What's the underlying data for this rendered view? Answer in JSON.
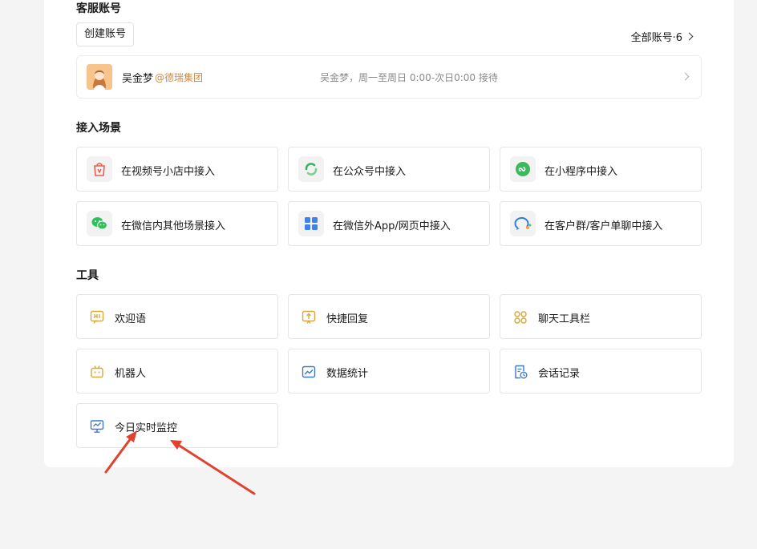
{
  "sections": {
    "accounts_title": "客服账号",
    "scenes_title": "接入场景",
    "tools_title": "工具"
  },
  "accounts": {
    "create_label": "创建账号",
    "all_label": "全部账号·6",
    "row": {
      "name": "吴金梦",
      "org": "@德瑞集团",
      "hours": "吴金梦，周一至周日 0:00-次日0:00 接待"
    }
  },
  "scenes": [
    {
      "label": "在视频号小店中接入",
      "icon": "shop-bag-icon",
      "color": "#e8604c"
    },
    {
      "label": "在公众号中接入",
      "icon": "official-account-icon",
      "color": "#2fb55d"
    },
    {
      "label": "在小程序中接入",
      "icon": "mini-program-icon",
      "color": "#3cb95c"
    },
    {
      "label": "在微信内其他场景接入",
      "icon": "wechat-icon",
      "color": "#2dc15a"
    },
    {
      "label": "在微信外App/网页中接入",
      "icon": "app-grid-icon",
      "color": "#3d82f0"
    },
    {
      "label": "在客户群/客户单聊中接入",
      "icon": "customer-chat-icon",
      "color": "#2f7de1"
    }
  ],
  "tools": [
    {
      "label": "欢迎语",
      "icon": "hi-bubble-icon",
      "color": "#d9a73a"
    },
    {
      "label": "快捷回复",
      "icon": "quick-reply-icon",
      "color": "#d9a73a"
    },
    {
      "label": "聊天工具栏",
      "icon": "toolbar-grid-icon",
      "color": "#d9a73a"
    },
    {
      "label": "机器人",
      "icon": "robot-icon",
      "color": "#d9a73a"
    },
    {
      "label": "数据统计",
      "icon": "chart-icon",
      "color": "#3d78c9"
    },
    {
      "label": "会话记录",
      "icon": "record-icon",
      "color": "#3d78c9"
    },
    {
      "label": "今日实时监控",
      "icon": "monitor-icon",
      "color": "#3d78c9"
    }
  ],
  "annotation_color": "#e0422f"
}
